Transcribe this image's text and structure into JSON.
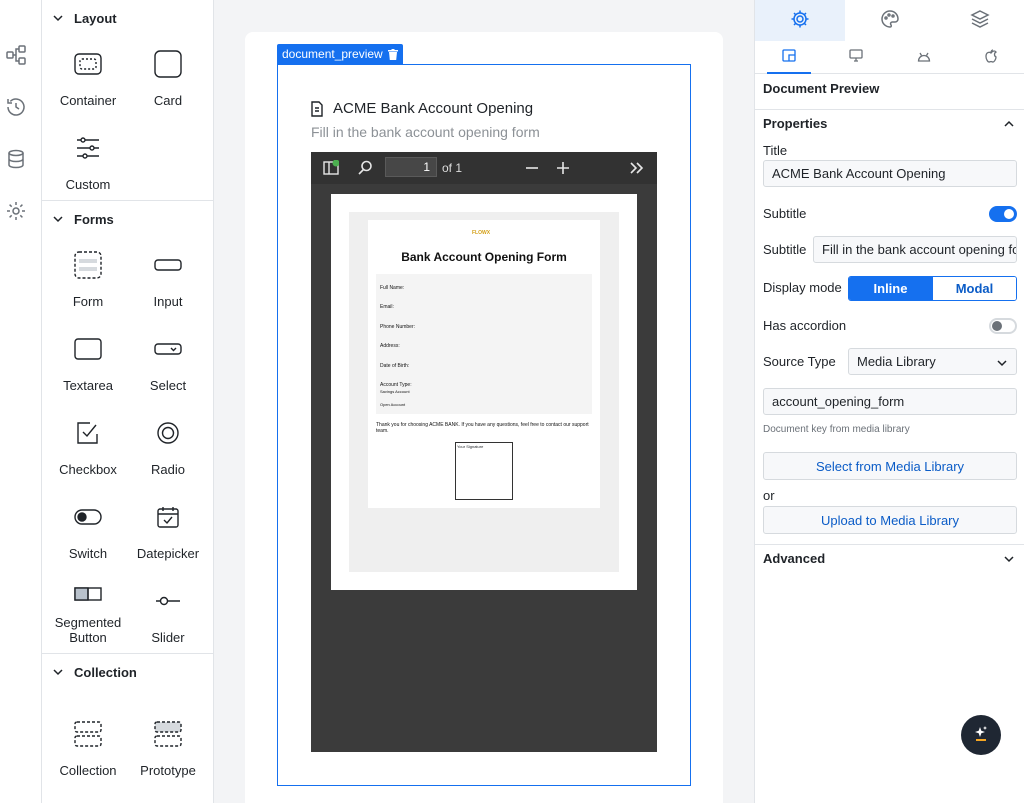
{
  "palette": {
    "sections": [
      {
        "title": "Layout",
        "items": [
          {
            "label": "Container",
            "icon": "container-icon"
          },
          {
            "label": "Card",
            "icon": "card-icon"
          },
          {
            "label": "Custom",
            "icon": "custom-icon"
          }
        ]
      },
      {
        "title": "Forms",
        "items": [
          {
            "label": "Form",
            "icon": "form-icon"
          },
          {
            "label": "Input",
            "icon": "input-icon"
          },
          {
            "label": "Textarea",
            "icon": "textarea-icon"
          },
          {
            "label": "Select",
            "icon": "select-icon"
          },
          {
            "label": "Checkbox",
            "icon": "checkbox-icon"
          },
          {
            "label": "Radio",
            "icon": "radio-icon"
          },
          {
            "label": "Switch",
            "icon": "switch-icon"
          },
          {
            "label": "Datepicker",
            "icon": "datepicker-icon"
          },
          {
            "label": "Segmented\nButton",
            "icon": "segmented-button-icon"
          },
          {
            "label": "Slider",
            "icon": "slider-icon"
          }
        ]
      },
      {
        "title": "Collection",
        "items": [
          {
            "label": "Collection",
            "icon": "collection-icon"
          },
          {
            "label": "Prototype",
            "icon": "prototype-icon"
          }
        ]
      }
    ]
  },
  "canvas": {
    "selection_tag": "document_preview",
    "preview_title": "ACME Bank Account Opening",
    "preview_subtitle": "Fill in the bank account opening form",
    "viewer": {
      "page_number": "1",
      "page_of": "of 1",
      "document": {
        "logo_text": "FLOWX",
        "title": "Bank Account Opening Form",
        "fields": [
          "Full Name:",
          "Email:",
          "Phone Number:",
          "Address:",
          "Date of Birth:",
          "Account Type:"
        ],
        "account_options": [
          "Savings Account",
          "Open Account"
        ],
        "thanks": "Thank you for choosing ACME BANK. If you have any questions, feel free to contact our support team.",
        "signature_label": "Your Signature"
      }
    }
  },
  "panel": {
    "component_name": "Document Preview",
    "properties_header": "Properties",
    "title_label": "Title",
    "title_value": "ACME Bank Account Opening",
    "subtitle_toggle_label": "Subtitle",
    "subtitle_toggle_on": true,
    "subtitle_label": "Subtitle",
    "subtitle_value": "Fill in the bank account opening form",
    "display_mode_label": "Display mode",
    "display_mode_options": [
      "Inline",
      "Modal"
    ],
    "display_mode_selected": "Inline",
    "has_accordion_label": "Has accordion",
    "has_accordion_on": false,
    "source_type_label": "Source Type",
    "source_type_value": "Media Library",
    "document_key_value": "account_opening_form",
    "document_key_hint": "Document key from media library",
    "select_button": "Select from Media Library",
    "or_text": "or",
    "upload_button": "Upload to Media Library",
    "advanced_header": "Advanced"
  },
  "colors": {
    "accent": "#1570ef",
    "toggle_off": "#6b7178"
  }
}
